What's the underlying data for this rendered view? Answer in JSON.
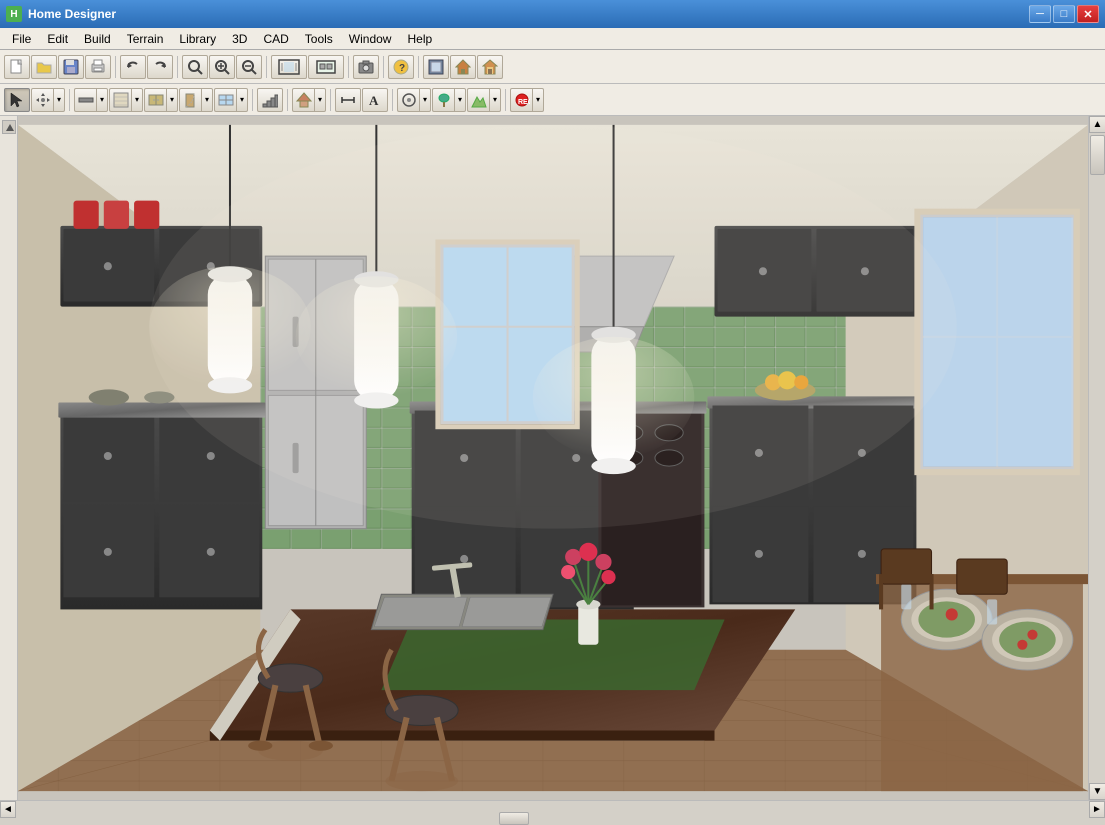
{
  "app": {
    "title": "Home Designer",
    "icon_label": "H"
  },
  "titlebar": {
    "minimize_label": "─",
    "maximize_label": "□",
    "close_label": "✕",
    "win_controls_minimize": "─",
    "win_controls_maximize": "□",
    "win_controls_close": "✕"
  },
  "menubar": {
    "items": [
      {
        "id": "file",
        "label": "File"
      },
      {
        "id": "edit",
        "label": "Edit"
      },
      {
        "id": "build",
        "label": "Build"
      },
      {
        "id": "terrain",
        "label": "Terrain"
      },
      {
        "id": "library",
        "label": "Library"
      },
      {
        "id": "3d",
        "label": "3D"
      },
      {
        "id": "cad",
        "label": "CAD"
      },
      {
        "id": "tools",
        "label": "Tools"
      },
      {
        "id": "window",
        "label": "Window"
      },
      {
        "id": "help",
        "label": "Help"
      }
    ]
  },
  "toolbar1": {
    "buttons": [
      {
        "id": "new",
        "icon": "📄",
        "tooltip": "New"
      },
      {
        "id": "open",
        "icon": "📂",
        "tooltip": "Open"
      },
      {
        "id": "save",
        "icon": "💾",
        "tooltip": "Save"
      },
      {
        "id": "print",
        "icon": "🖨",
        "tooltip": "Print"
      },
      {
        "id": "undo",
        "icon": "↩",
        "tooltip": "Undo"
      },
      {
        "id": "redo",
        "icon": "↪",
        "tooltip": "Redo"
      },
      {
        "id": "zoom-in-glass",
        "icon": "🔍",
        "tooltip": "Zoom In"
      },
      {
        "id": "zoom-in",
        "icon": "⊕",
        "tooltip": "Zoom In Fixed"
      },
      {
        "id": "zoom-out",
        "icon": "⊖",
        "tooltip": "Zoom Out Fixed"
      },
      {
        "id": "fill-window",
        "icon": "⤢",
        "tooltip": "Fill Window"
      },
      {
        "id": "plan-view",
        "icon": "⊞",
        "tooltip": "Plan View"
      },
      {
        "id": "camera",
        "icon": "📷",
        "tooltip": "Camera"
      },
      {
        "id": "question",
        "icon": "?",
        "tooltip": "Help"
      },
      {
        "id": "wall-height",
        "icon": "⬛",
        "tooltip": "Wall Height"
      },
      {
        "id": "exterior",
        "icon": "🏠",
        "tooltip": "Exterior"
      },
      {
        "id": "interior",
        "icon": "🏡",
        "tooltip": "Interior"
      }
    ]
  },
  "toolbar2": {
    "buttons": [
      {
        "id": "select",
        "icon": "↖",
        "tooltip": "Select Objects"
      },
      {
        "id": "pan",
        "icon": "✋",
        "tooltip": "Pan"
      },
      {
        "id": "wall",
        "icon": "⊢",
        "tooltip": "Draw Wall"
      },
      {
        "id": "floor",
        "icon": "▦",
        "tooltip": "Floor"
      },
      {
        "id": "cabinet",
        "icon": "▬",
        "tooltip": "Cabinet"
      },
      {
        "id": "door",
        "icon": "▭",
        "tooltip": "Door"
      },
      {
        "id": "window-tool",
        "icon": "⬜",
        "tooltip": "Window"
      },
      {
        "id": "stairs",
        "icon": "≡",
        "tooltip": "Stairs"
      },
      {
        "id": "roof",
        "icon": "⌂",
        "tooltip": "Roof"
      },
      {
        "id": "dimension",
        "icon": "↔",
        "tooltip": "Dimension"
      },
      {
        "id": "text-tool",
        "icon": "T",
        "tooltip": "Text"
      },
      {
        "id": "object",
        "icon": "◎",
        "tooltip": "Object"
      },
      {
        "id": "plant",
        "icon": "🌿",
        "tooltip": "Plant"
      },
      {
        "id": "terrain-tool",
        "icon": "🏔",
        "tooltip": "Terrain"
      },
      {
        "id": "record",
        "icon": "⏺",
        "tooltip": "Record"
      }
    ]
  },
  "scene": {
    "description": "3D kitchen interior view with dark cabinets, green tile backsplash, hardwood floors, pendant lights, and kitchen island"
  },
  "statusbar": {
    "left_arrow": "◄",
    "right_arrow": "►",
    "up_arrow": "▲",
    "down_arrow": "▼"
  }
}
